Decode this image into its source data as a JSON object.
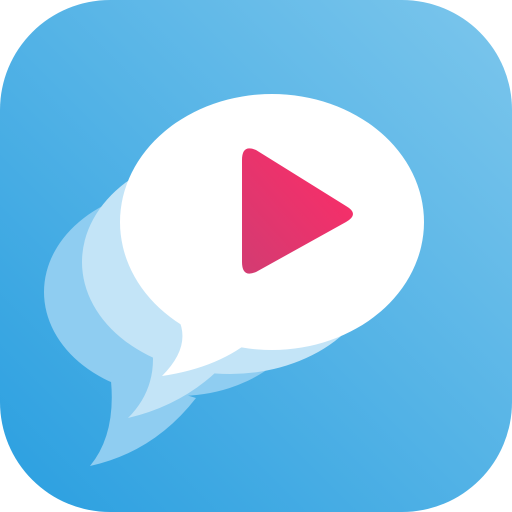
{
  "app_icon": {
    "icon": "chat-bubble-play-icon",
    "colors": {
      "background_top_right": "#7cc6ec",
      "background_bottom_left": "#2a9fe0",
      "bubble_front": "#ffffff",
      "bubble_middle": "#c3e4f7",
      "bubble_back": "#8fcdf1",
      "play_start": "#d23c72",
      "play_end": "#ff2b67"
    }
  }
}
